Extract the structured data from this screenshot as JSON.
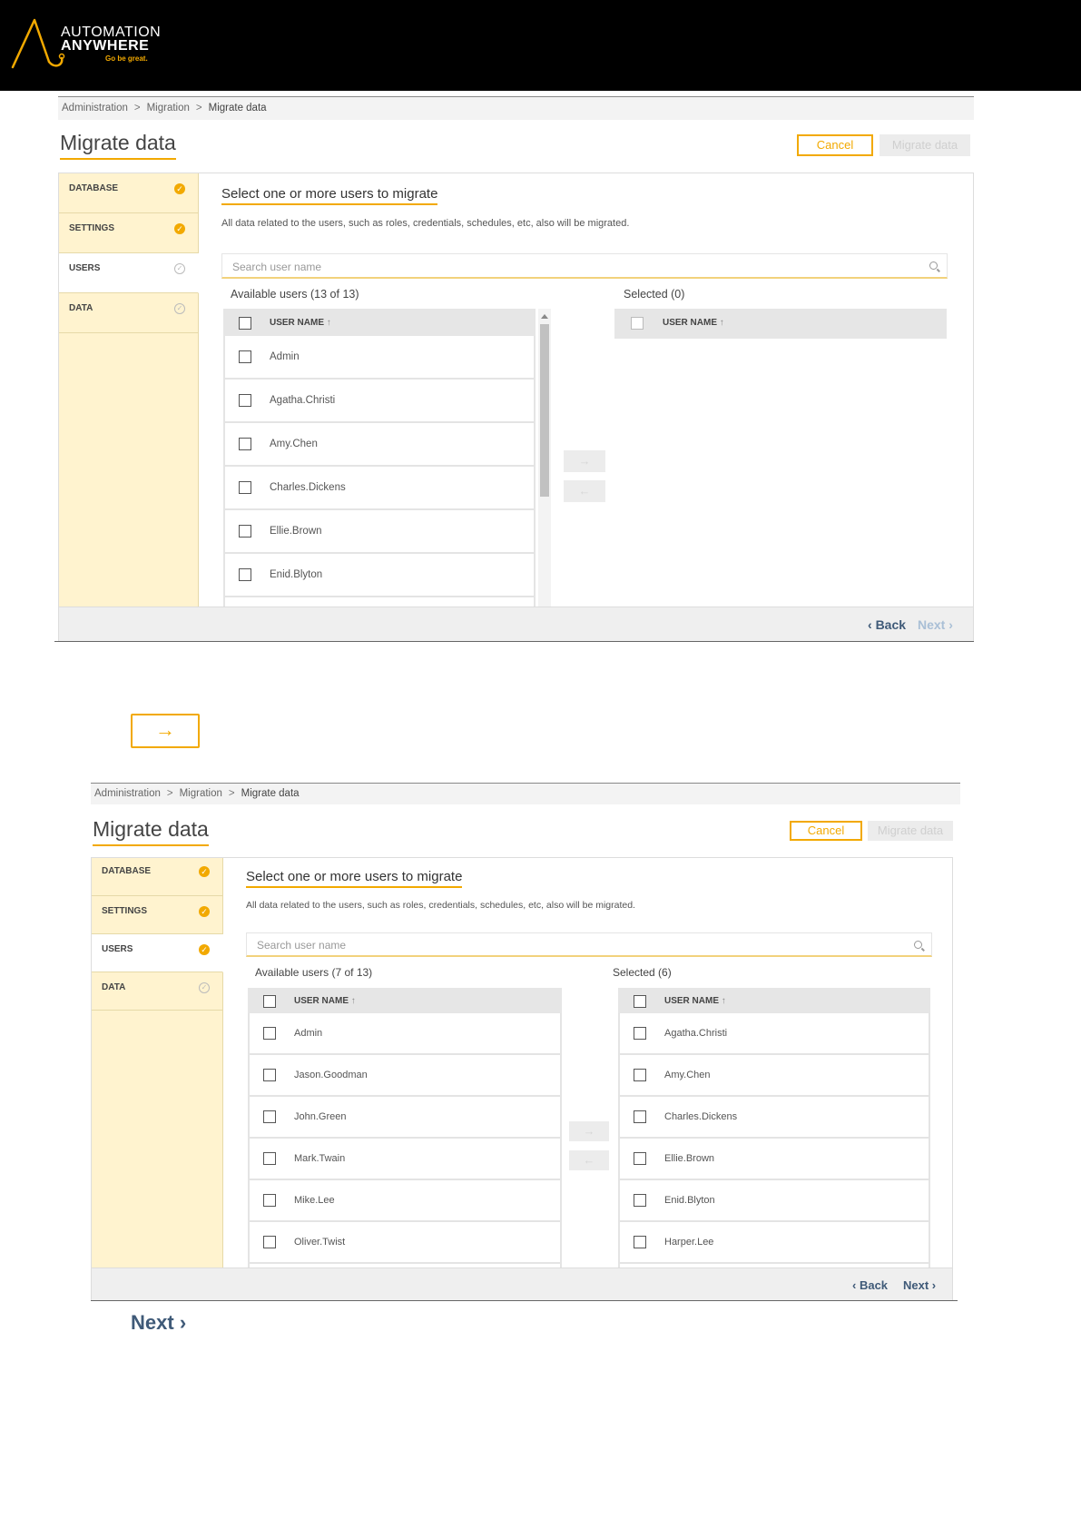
{
  "brand": {
    "line1": "AUTOMATION",
    "line2": "ANYWHERE",
    "tagline": "Go be great."
  },
  "screen1": {
    "breadcrumb": [
      "Administration",
      "Migration",
      "Migrate data"
    ],
    "title": "Migrate data",
    "cancel": "Cancel",
    "migrate": "Migrate data",
    "steps": [
      {
        "label": "DATABASE",
        "done": true
      },
      {
        "label": "SETTINGS",
        "done": true
      },
      {
        "label": "USERS",
        "done": false
      },
      {
        "label": "DATA",
        "done": false
      }
    ],
    "heading": "Select one or more users to migrate",
    "description": "All data related to the users, such as roles, credentials, schedules, etc, also will be migrated.",
    "search_placeholder": "Search user name",
    "available_label": "Available users  (13 of 13)",
    "selected_label": "Selected  (0)",
    "column_header": "USER NAME",
    "sort_glyph": "↑",
    "available": [
      "Admin",
      "Agatha.Christi",
      "Amy.Chen",
      "Charles.Dickens",
      "Ellie.Brown",
      "Enid.Blyton"
    ],
    "selected": [],
    "move_right": "→",
    "move_left": "←",
    "back": "Back",
    "next": "Next"
  },
  "callout_arrow": "→",
  "screen2": {
    "breadcrumb": [
      "Administration",
      "Migration",
      "Migrate data"
    ],
    "title": "Migrate data",
    "cancel": "Cancel",
    "migrate": "Migrate data",
    "steps": [
      {
        "label": "DATABASE",
        "done": true
      },
      {
        "label": "SETTINGS",
        "done": true
      },
      {
        "label": "USERS",
        "done": true
      },
      {
        "label": "DATA",
        "done": false
      }
    ],
    "heading": "Select one or more users to migrate",
    "description": "All data related to the users, such as roles, credentials, schedules, etc, also will be migrated.",
    "search_placeholder": "Search user name",
    "available_label": "Available users  (7 of 13)",
    "selected_label": "Selected  (6)",
    "column_header": "USER NAME",
    "sort_glyph": "↑",
    "available": [
      "Admin",
      "Jason.Goodman",
      "John.Green",
      "Mark.Twain",
      "Mike.Lee",
      "Oliver.Twist"
    ],
    "selected": [
      "Agatha.Christi",
      "Amy.Chen",
      "Charles.Dickens",
      "Ellie.Brown",
      "Enid.Blyton",
      "Harper.Lee"
    ],
    "move_right": "→",
    "move_left": "←",
    "back": "Back",
    "next": "Next"
  },
  "callout_next": "Next",
  "colors": {
    "accent": "#f2a900",
    "nav": "#3f5a78",
    "sidebar": "#fff3cf"
  }
}
